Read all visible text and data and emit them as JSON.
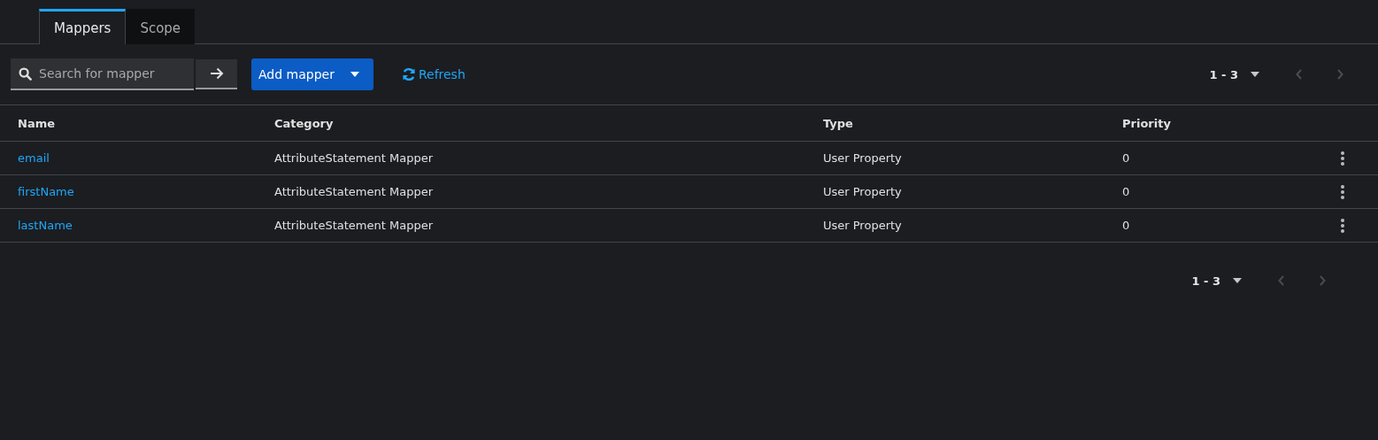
{
  "tabs": [
    {
      "label": "Mappers",
      "selected": true
    },
    {
      "label": "Scope",
      "selected": false
    }
  ],
  "toolbar": {
    "search": {
      "placeholder": "Search for mapper"
    },
    "add_button": "Add mapper",
    "refresh": "Refresh"
  },
  "pagination_top": {
    "range": "1 - 3",
    "prev_disabled": true,
    "next_disabled": true
  },
  "table": {
    "columns": [
      "Name",
      "Category",
      "Type",
      "Priority"
    ],
    "rows": [
      {
        "name": "email",
        "category": "AttributeStatement Mapper",
        "type": "User Property",
        "priority": "0"
      },
      {
        "name": "firstName",
        "category": "AttributeStatement Mapper",
        "type": "User Property",
        "priority": "0"
      },
      {
        "name": "lastName",
        "category": "AttributeStatement Mapper",
        "type": "User Property",
        "priority": "0"
      }
    ]
  },
  "pagination_bottom": {
    "range": "1 - 3",
    "prev_disabled": true,
    "next_disabled": true
  }
}
